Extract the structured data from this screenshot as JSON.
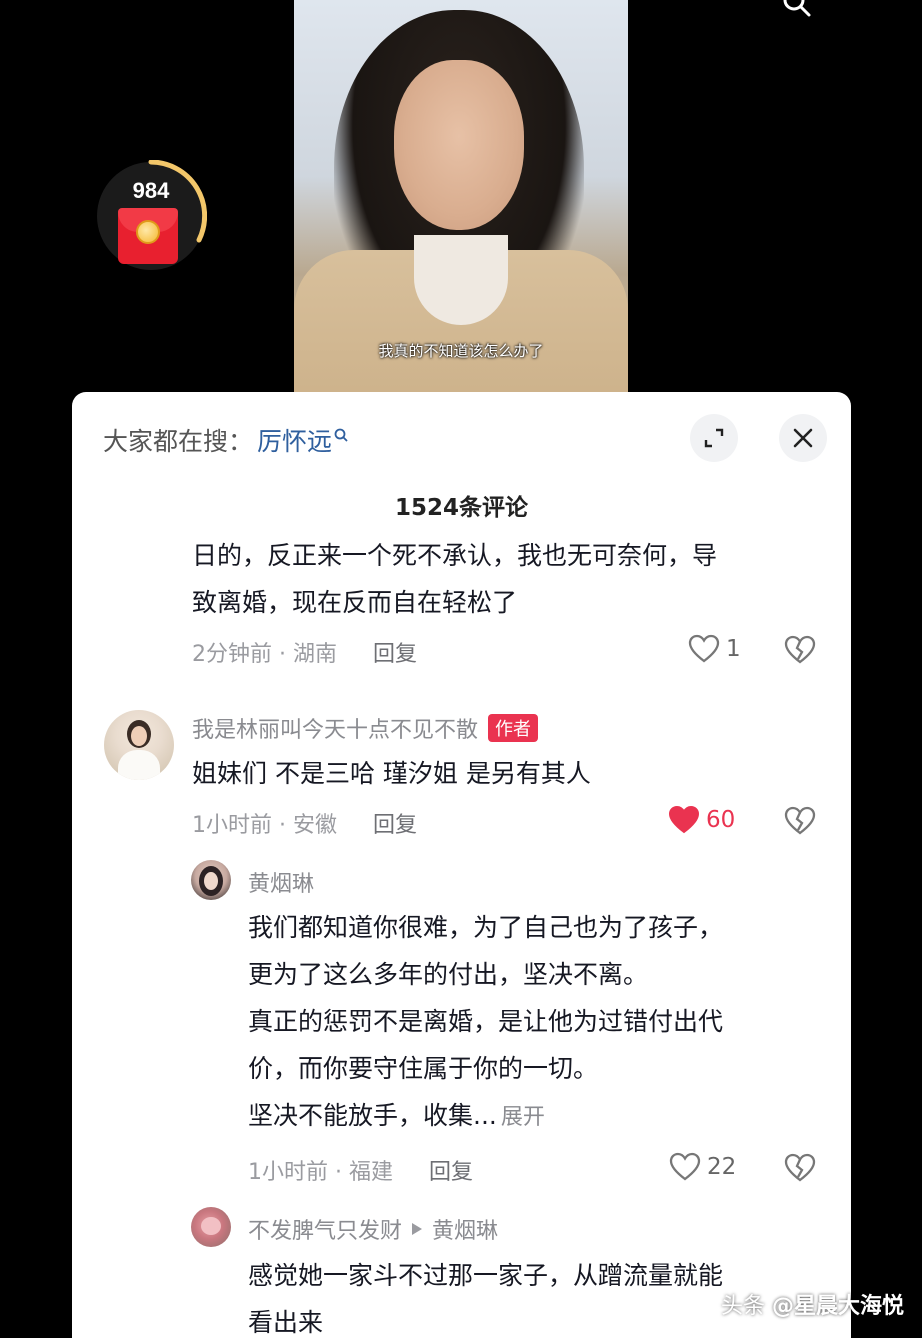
{
  "video": {
    "subtitle": "我真的不知道该怎么办了"
  },
  "red_packet": {
    "count": "984"
  },
  "header": {
    "search_prefix": "大家都在搜：",
    "search_keyword": "厉怀远",
    "comment_count": "1524条评论"
  },
  "comments": [
    {
      "text_lines": [
        "日的，反正来一个死不承认，我也无可奈何，导",
        "致离婚，现在反而自在轻松了"
      ],
      "meta_time": "2分钟前 · 湖南",
      "reply": "回复",
      "likes": "1"
    },
    {
      "username": "我是林丽叫今天十点不见不散",
      "badge": "作者",
      "text": "姐妹们 不是三哈 瑾汐姐 是另有其人",
      "meta_time": "1小时前 · 安徽",
      "reply": "回复",
      "likes": "60"
    },
    {
      "username": "黄烟琳",
      "text_lines": [
        "我们都知道你很难，为了自己也为了孩子，",
        "更为了这么多年的付出，坚决不离。",
        "真正的惩罚不是离婚，是让他为过错付出代",
        "价，而你要守住属于你的一切。",
        "坚决不能放手，收集..."
      ],
      "expand": "展开",
      "meta_time": "1小时前 · 福建",
      "reply": "回复",
      "likes": "22"
    },
    {
      "username": "不发脾气只发财",
      "reply_to": "黄烟琳",
      "text_lines": [
        "感觉她一家斗不过那一家子，从蹭流量就能",
        "看出来"
      ]
    }
  ],
  "watermark": {
    "platform": "头条",
    "handle": "@星晨大海悦"
  },
  "colors": {
    "like_red": "#ea3350",
    "keyword_blue": "#2f5f9e",
    "badge_red": "#ea3350"
  }
}
